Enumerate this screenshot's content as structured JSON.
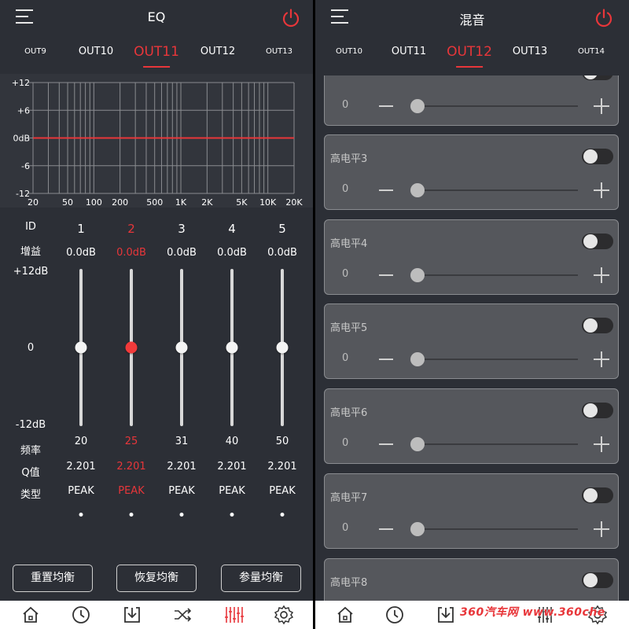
{
  "left_screen": {
    "title": "EQ",
    "tabs": [
      "OUT9",
      "OUT10",
      "OUT11",
      "OUT12",
      "OUT13"
    ],
    "active_tab": "OUT11",
    "graph": {
      "y_labels": [
        "+12",
        "+6",
        "0dB",
        "-6",
        "-12"
      ],
      "x_labels": [
        "20",
        "50",
        "100",
        "200",
        "500",
        "1K",
        "2K",
        "5K",
        "10K",
        "20K"
      ],
      "curve_level_db": 0
    },
    "row_labels": {
      "id": "ID",
      "gain": "增益",
      "max": "+12dB",
      "mid": "0",
      "min": "-12dB",
      "freq": "频率",
      "q": "Q值",
      "type": "类型"
    },
    "bands": [
      {
        "id": "1",
        "gain": "0.0dB",
        "freq": "20",
        "q": "2.201",
        "type": "PEAK",
        "level": 0,
        "selected": false
      },
      {
        "id": "2",
        "gain": "0.0dB",
        "freq": "25",
        "q": "2.201",
        "type": "PEAK",
        "level": 0,
        "selected": true
      },
      {
        "id": "3",
        "gain": "0.0dB",
        "freq": "31",
        "q": "2.201",
        "type": "PEAK",
        "level": 0,
        "selected": false
      },
      {
        "id": "4",
        "gain": "0.0dB",
        "freq": "40",
        "q": "2.201",
        "type": "PEAK",
        "level": 0,
        "selected": false
      },
      {
        "id": "5",
        "gain": "0.0dB",
        "freq": "50",
        "q": "2.201",
        "type": "PEAK",
        "level": 0,
        "selected": false
      }
    ],
    "buttons": {
      "reset": "重置均衡",
      "restore": "恢复均衡",
      "param": "参量均衡"
    }
  },
  "right_screen": {
    "title": "混音",
    "tabs": [
      "OUT10",
      "OUT11",
      "OUT12",
      "OUT13",
      "OUT14"
    ],
    "active_tab": "OUT12",
    "cards": [
      {
        "title": "",
        "value": "0",
        "on": false
      },
      {
        "title": "高电平3",
        "value": "0",
        "on": false
      },
      {
        "title": "高电平4",
        "value": "0",
        "on": false
      },
      {
        "title": "高电平5",
        "value": "0",
        "on": false
      },
      {
        "title": "高电平6",
        "value": "0",
        "on": false
      },
      {
        "title": "高电平7",
        "value": "0",
        "on": false
      },
      {
        "title": "高电平8",
        "value": "",
        "on": false
      }
    ]
  },
  "bottom_nav": [
    "home-icon",
    "clock-icon",
    "download-icon",
    "shuffle-icon",
    "eq-sliders-icon",
    "settings-icon"
  ],
  "watermark": "360汽车网 www.360che",
  "colors": {
    "accent": "#e8363a",
    "background": "#2c2f36",
    "card": "#55575c",
    "bottom_bar": "#ffffff"
  }
}
